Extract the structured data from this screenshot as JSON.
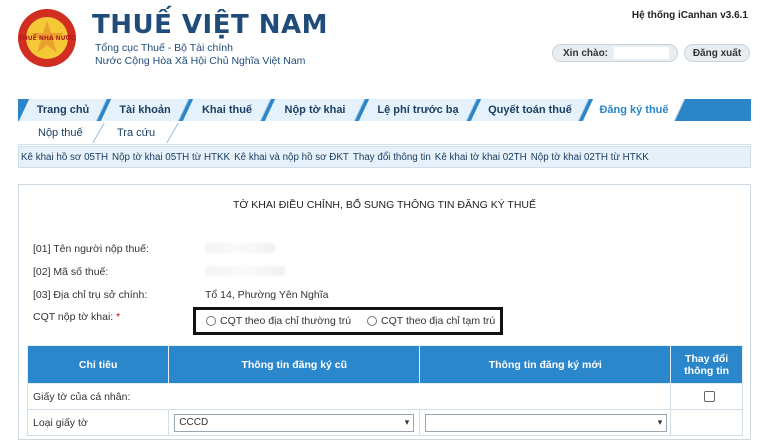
{
  "header": {
    "logo_text": "THUẾ NHÀ NƯỚC",
    "title": "THUẾ VIỆT NAM",
    "subtitle1": "Tổng cục Thuế - Bộ Tài chính",
    "subtitle2": "Nước Cộng Hòa Xã Hội Chủ Nghĩa Việt Nam",
    "version": "Hệ thống iCanhan v3.6.1",
    "greeting_label": "Xin chào:",
    "logout_label": "Đăng xuất"
  },
  "nav": {
    "tabs": [
      {
        "label": "Trang chủ"
      },
      {
        "label": "Tài khoản"
      },
      {
        "label": "Khai thuế"
      },
      {
        "label": "Nộp tờ khai"
      },
      {
        "label": "Lệ phí trước bạ"
      },
      {
        "label": "Quyết toán thuế"
      },
      {
        "label": "Đăng ký thuế"
      }
    ],
    "active_tab": "Đăng ký thuế"
  },
  "subnav": {
    "items": [
      {
        "label": "Nộp thuế"
      },
      {
        "label": "Tra cứu"
      }
    ]
  },
  "linkbar": {
    "links": [
      {
        "label": "Kê khai hồ sơ 05TH"
      },
      {
        "label": "Nộp tờ khai 05TH từ HTKK"
      },
      {
        "label": "Kê khai và nộp hồ sơ ĐKT"
      },
      {
        "label": "Thay đổi thông tin"
      },
      {
        "label": "Kê khai tờ khai 02TH"
      },
      {
        "label": "Nộp tờ khai 02TH từ HTKK"
      }
    ]
  },
  "form": {
    "title": "TỜ KHAI ĐIỀU CHỈNH, BỔ SUNG THÔNG TIN ĐĂNG KÝ THUẾ",
    "fields": {
      "f01_label": "[01] Tên người nộp thuế:",
      "f02_label": "[02] Mã số thuế:",
      "f03_label": "[03] Địa chỉ trụ sở chính:",
      "f03_value": "Tổ 14, Phường Yên Nghĩa",
      "cqt_label": "CQT nộp tờ khai:",
      "cqt_required": "*"
    },
    "radio_options": [
      {
        "label": "CQT theo địa chỉ thường trú"
      },
      {
        "label": "CQT theo địa chỉ tạm trú"
      }
    ],
    "table": {
      "headers": [
        "Chỉ tiêu",
        "Thông tin đăng ký cũ",
        "Thông tin đăng ký mới",
        "Thay đổi thông tin"
      ],
      "rows": [
        {
          "label": "Giấy tờ của cá nhân:"
        },
        {
          "label": "Loại giấy tờ",
          "old_value": "CCCD",
          "new_value": ""
        }
      ]
    }
  },
  "colors": {
    "brand_blue": "#1f4c7a",
    "nav_blue": "#2b85c8",
    "table_header": "#2b87cc"
  }
}
